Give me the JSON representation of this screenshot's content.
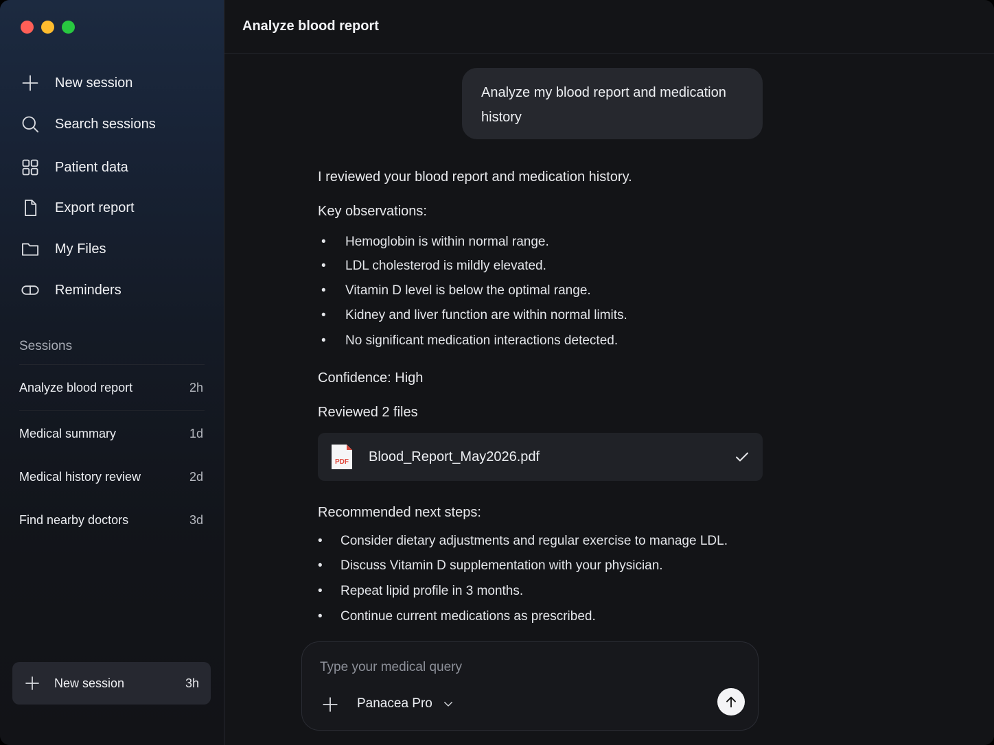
{
  "window": {
    "traffic_colors": [
      "#ff5f57",
      "#febc2e",
      "#28c840"
    ]
  },
  "sidebar": {
    "nav": [
      {
        "label": "New session",
        "icon": "plus-icon"
      },
      {
        "label": "Search sessions",
        "icon": "search-icon"
      },
      {
        "label": "Patient data",
        "icon": "grid-icon"
      },
      {
        "label": "Export report",
        "icon": "document-icon"
      },
      {
        "label": "My Files",
        "icon": "folder-icon"
      },
      {
        "label": "Reminders",
        "icon": "pill-icon"
      }
    ],
    "sessions_title": "Sessions",
    "sessions": [
      {
        "title": "Analyze blood report",
        "time": "2h"
      },
      {
        "title": "Medical summary",
        "time": "1d"
      },
      {
        "title": "Medical history review",
        "time": "2d"
      },
      {
        "title": "Find nearby doctors",
        "time": "3d"
      }
    ],
    "bottom": {
      "label": "New session",
      "time": "3h"
    }
  },
  "main": {
    "title": "Analyze blood report",
    "user_message": "Analyze my blood report and medication history",
    "intro": "I reviewed your blood report and medication history.",
    "observations_title": "Key observations:",
    "observations": [
      "Hemoglobin is within normal range.",
      "LDL cholesterod is mildly elevated.",
      "Vitamin D level is below the optimal range.",
      "Kidney and liver function are within normal limits.",
      "No significant medication interactions detected."
    ],
    "confidence": "Confidence: High",
    "reviewed": "Reviewed 2 files",
    "file": {
      "name": "Blood_Report_May2026.pdf",
      "badge": "PDF"
    },
    "next_steps_title": "Recommended next steps:",
    "next_steps": [
      "Consider dietary adjustments and regular exercise to manage LDL.",
      "Discuss Vitamin D supplementation with your physician.",
      "Repeat lipid profile in 3 months.",
      "Continue current medications as prescribed."
    ],
    "composer": {
      "placeholder": "Type your medical query",
      "model": "Panacea Pro"
    },
    "bullet_char": "•"
  }
}
